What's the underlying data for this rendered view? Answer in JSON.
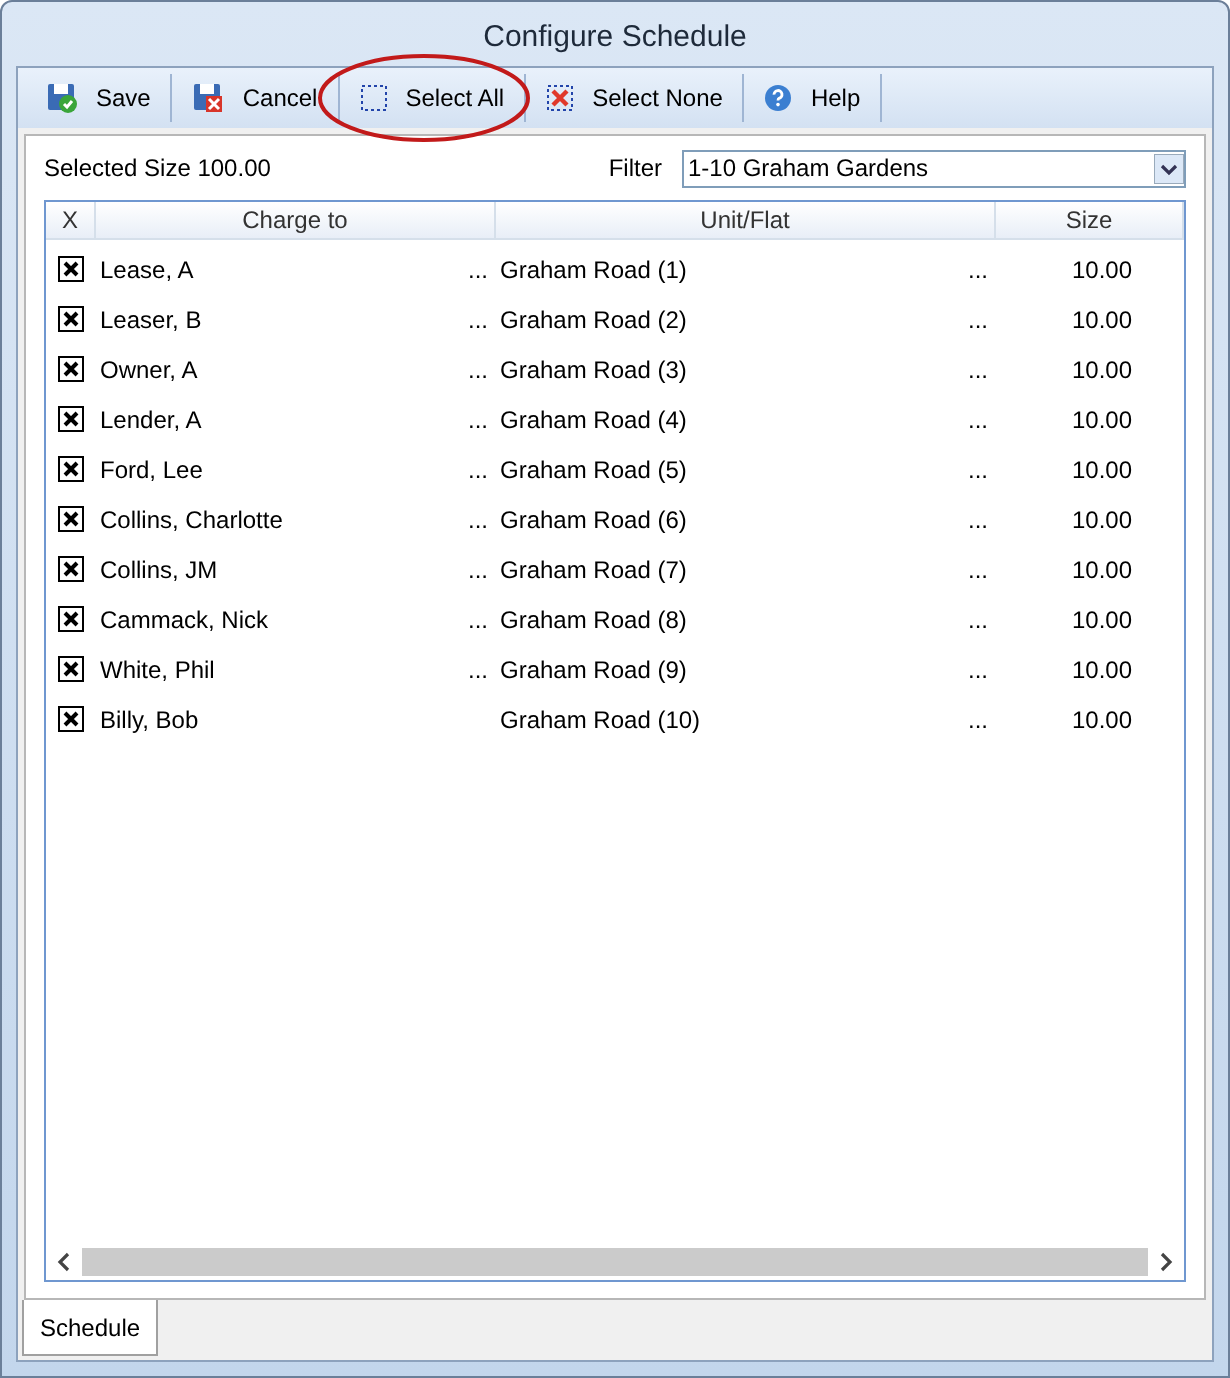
{
  "window": {
    "title": "Configure Schedule"
  },
  "toolbar": [
    {
      "label": "Save",
      "kind": "save",
      "highlighted": false
    },
    {
      "label": "Cancel",
      "kind": "cancel",
      "highlighted": false
    },
    {
      "label": "Select All",
      "kind": "select-all",
      "highlighted": true
    },
    {
      "label": "Select None",
      "kind": "select-none",
      "highlighted": false
    },
    {
      "label": "Help",
      "kind": "help",
      "highlighted": false
    }
  ],
  "selected_size": "Selected Size 100.00",
  "filter": {
    "label": "Filter",
    "value": "1-10 Graham Gardens"
  },
  "table": {
    "columns": [
      "X",
      "Charge to",
      "Unit/Flat",
      "Size"
    ],
    "rows": [
      {
        "checked": true,
        "charge_to": "Lease, A",
        "charge_more": "...",
        "unit": "Graham Road (1)",
        "unit_more": "...",
        "size": "10.00"
      },
      {
        "checked": true,
        "charge_to": "Leaser, B",
        "charge_more": "...",
        "unit": "Graham Road (2)",
        "unit_more": "...",
        "size": "10.00"
      },
      {
        "checked": true,
        "charge_to": "Owner, A",
        "charge_more": "...",
        "unit": "Graham Road (3)",
        "unit_more": "...",
        "size": "10.00"
      },
      {
        "checked": true,
        "charge_to": "Lender, A",
        "charge_more": "...",
        "unit": "Graham Road (4)",
        "unit_more": "...",
        "size": "10.00"
      },
      {
        "checked": true,
        "charge_to": "Ford, Lee",
        "charge_more": "...",
        "unit": "Graham Road (5)",
        "unit_more": "...",
        "size": "10.00"
      },
      {
        "checked": true,
        "charge_to": "Collins, Charlotte",
        "charge_more": "...",
        "unit": "Graham Road (6)",
        "unit_more": "...",
        "size": "10.00"
      },
      {
        "checked": true,
        "charge_to": "Collins, JM",
        "charge_more": "...",
        "unit": "Graham Road (7)",
        "unit_more": "...",
        "size": "10.00"
      },
      {
        "checked": true,
        "charge_to": "Cammack, Nick",
        "charge_more": "...",
        "unit": "Graham Road (8)",
        "unit_more": "...",
        "size": "10.00"
      },
      {
        "checked": true,
        "charge_to": "White, Phil",
        "charge_more": "...",
        "unit": "Graham Road (9)",
        "unit_more": "...",
        "size": "10.00"
      },
      {
        "checked": true,
        "charge_to": "Billy, Bob",
        "unit": "Graham Road (10)",
        "unit_more": "...",
        "size": "10.00"
      }
    ]
  },
  "tabs": [
    {
      "label": "Schedule",
      "selected": true
    }
  ]
}
